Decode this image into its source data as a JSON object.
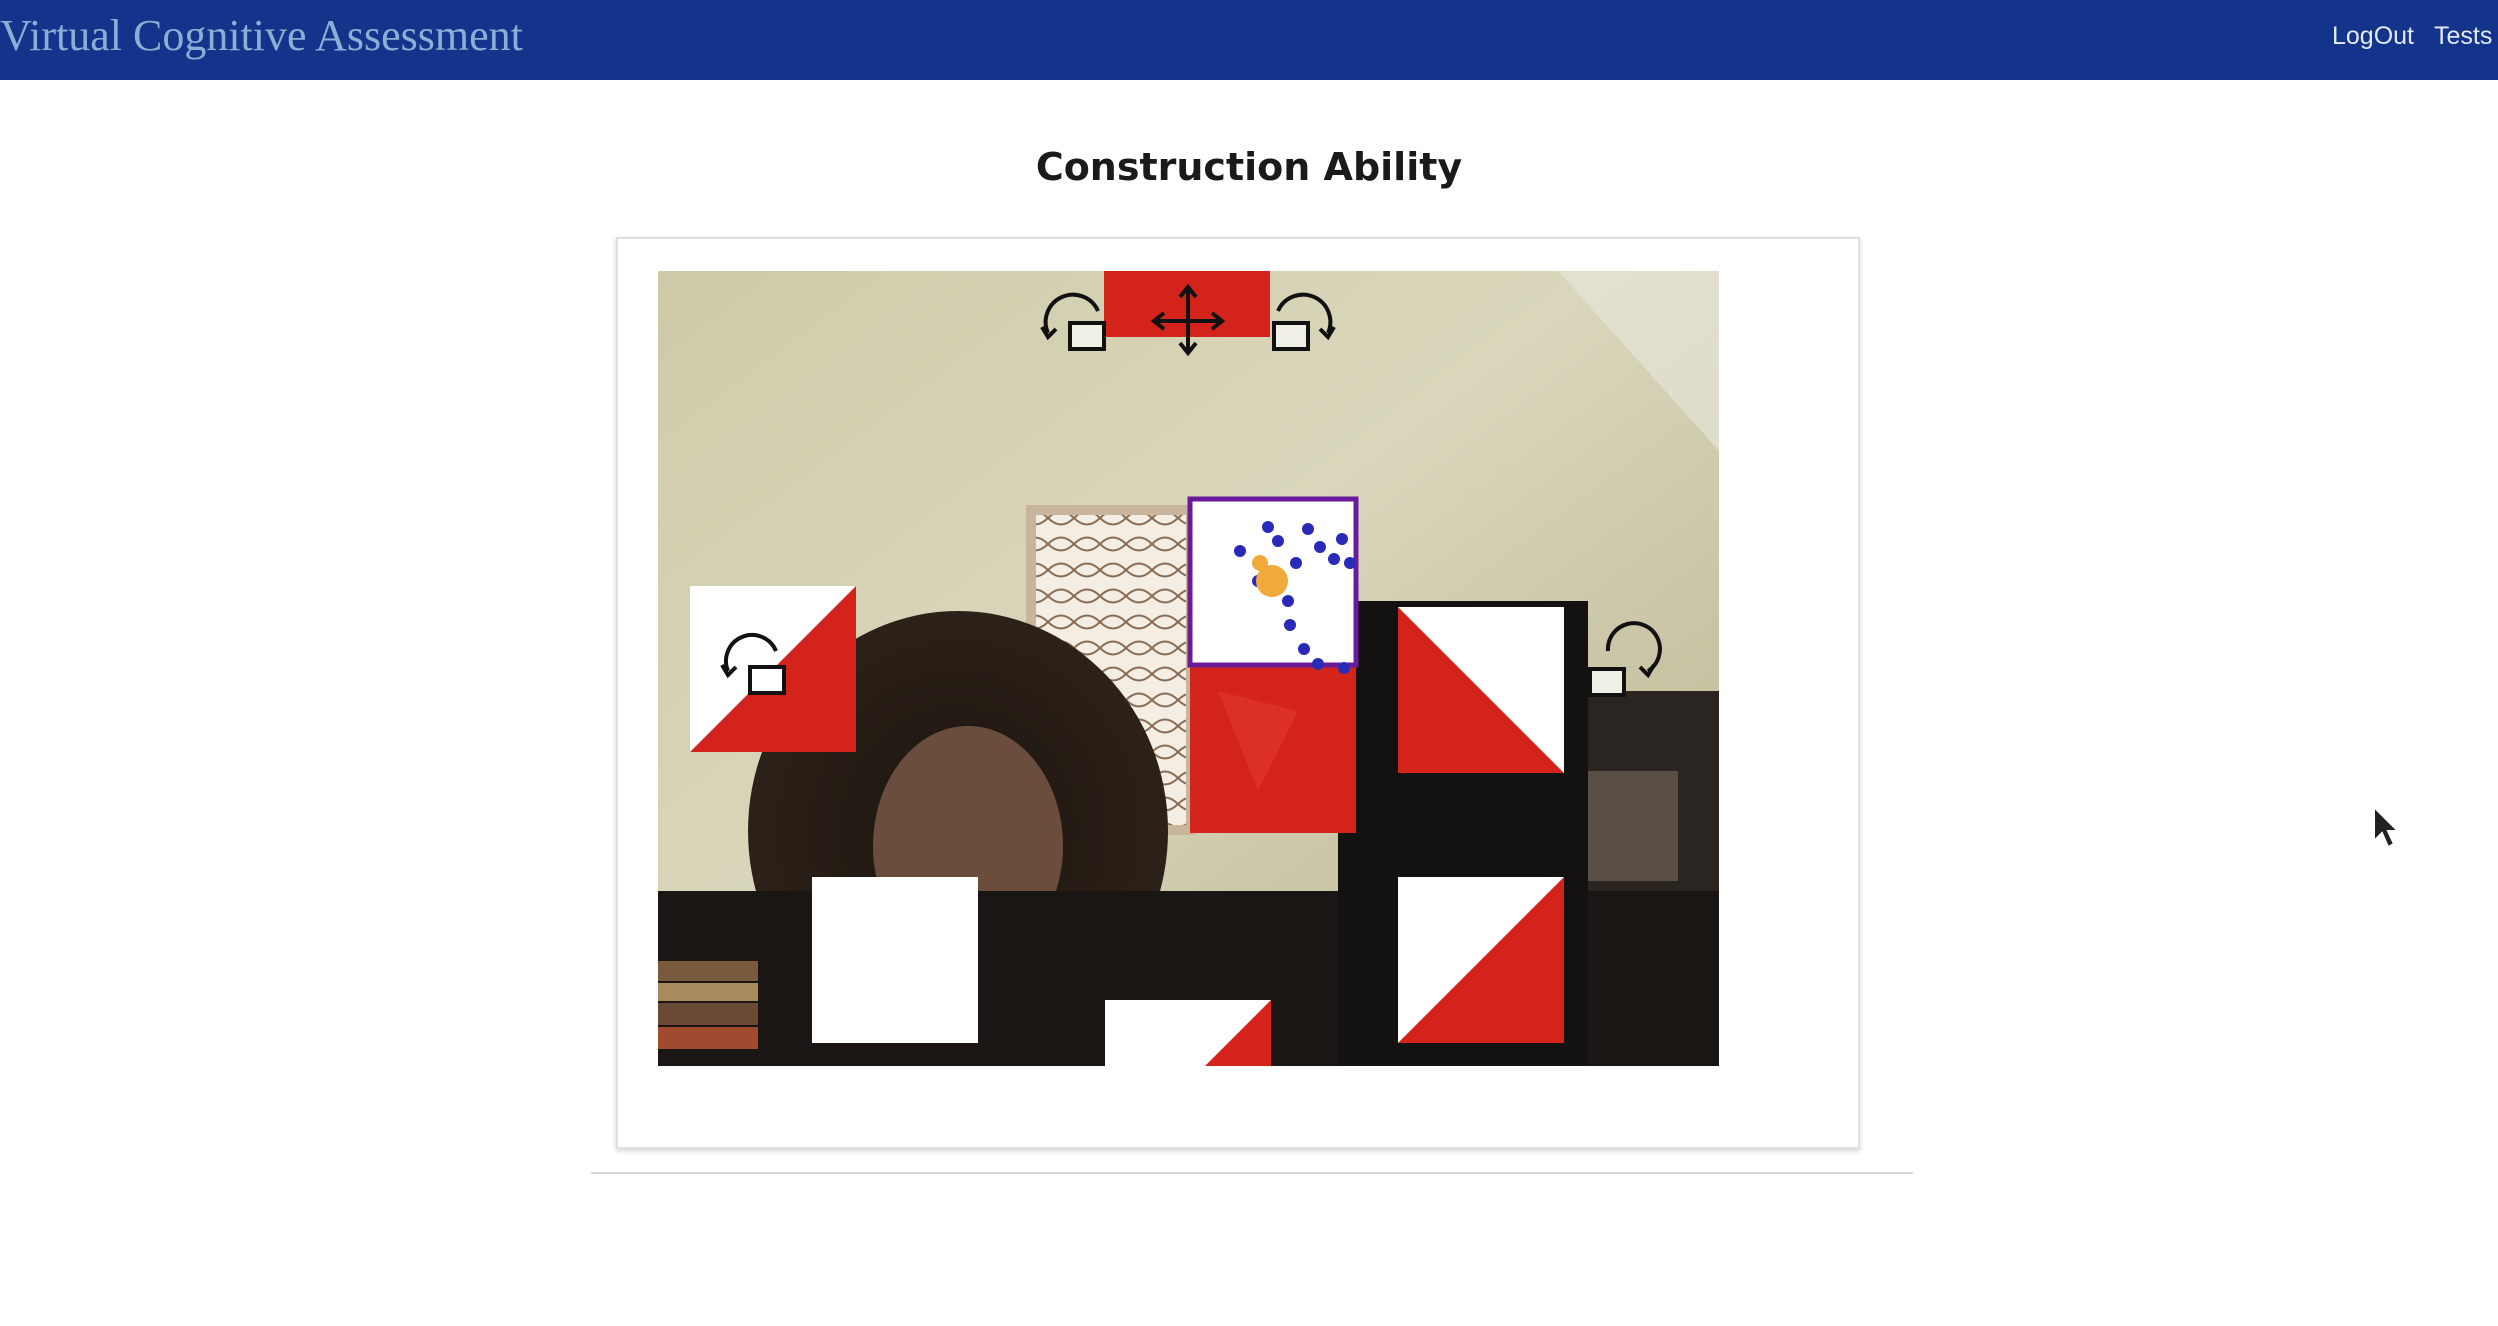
{
  "header": {
    "app_title": "Virtual Cognitive Assessment",
    "nav": {
      "logout": "LogOut",
      "tests": "Tests"
    },
    "background_color": "#14338a"
  },
  "main": {
    "page_title": "Construction Ability"
  },
  "puzzle": {
    "block_color": "#d4231b",
    "selection_color": "#6a1b9a",
    "landmark_color": "#2a2ab8",
    "cursor_color": "#f2a93b",
    "icons": [
      "rotate-left-icon",
      "move-icon",
      "rotate-right-icon"
    ]
  }
}
